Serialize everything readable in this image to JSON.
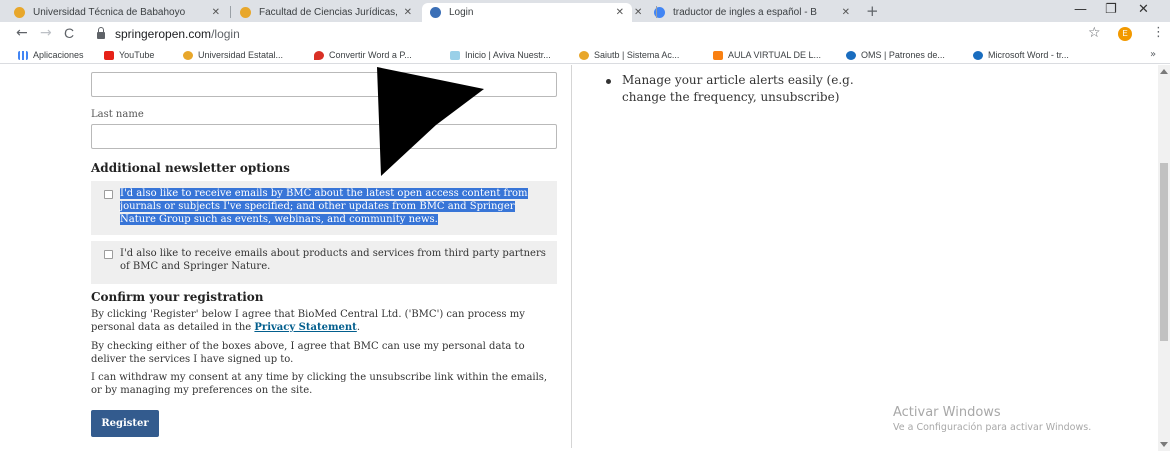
{
  "browser": {
    "tabs": [
      {
        "title": "Universidad Técnica de Babahoyo",
        "fav_color": "#e8a72b"
      },
      {
        "title": "Facultad de Ciencias Jurídicas, So",
        "fav_color": "#e8a72b"
      },
      {
        "title": "Login",
        "fav_color": "#3b6fb6"
      },
      {
        "title": "traductor de ingles a español - B",
        "fav_color": "#4285f4"
      }
    ],
    "close_glyph": "✕",
    "new_tab": "+",
    "window_controls": {
      "minimize": "—",
      "restore": "❐",
      "close": "✕"
    },
    "nav": {
      "back": "←",
      "forward": "→",
      "reload": "C"
    },
    "address": {
      "host": "springeropen.com",
      "path": "/login"
    },
    "star": "☆",
    "profile_initial": "E",
    "menu_glyph": "⋮"
  },
  "bookmarks": {
    "items": [
      {
        "label": "Aplicaciones",
        "icon": "apps-grid-icon",
        "color": "#4285f4"
      },
      {
        "label": "YouTube",
        "icon": "youtube-icon",
        "color": "#e62117"
      },
      {
        "label": "Universidad Estatal...",
        "icon": "university-icon",
        "color": "#e8a72b"
      },
      {
        "label": "Convertir Word a P...",
        "icon": "heart-icon",
        "color": "#d93025"
      },
      {
        "label": "Inicio | Aviva Nuestr...",
        "icon": "aviva-icon",
        "color": "#9ad0e8"
      },
      {
        "label": "Saiutb | Sistema Ac...",
        "icon": "saiutb-icon",
        "color": "#e8a72b"
      },
      {
        "label": "AULA VIRTUAL DE L...",
        "icon": "moodle-icon",
        "color": "#f98012"
      },
      {
        "label": "OMS | Patrones de...",
        "icon": "oms-icon",
        "color": "#1a6dbf"
      },
      {
        "label": "Microsoft Word - tr...",
        "icon": "oms-icon",
        "color": "#1a6dbf"
      }
    ],
    "more": "»"
  },
  "form": {
    "last_name_label": "Last name",
    "newsletter_heading": "Additional newsletter options",
    "option1": "I'd also like to receive emails by BMC about the latest open access content from journals or subjects I've specified; and other updates from BMC and Springer Nature Group such as events, webinars, and community news.",
    "option2": "I'd also like to receive emails about products and services from third party partners of BMC and Springer Nature.",
    "confirm_heading": "Confirm your registration",
    "para1_before": "By clicking 'Register' below I agree that BioMed Central Ltd. ('BMC') can process my personal data as detailed in the ",
    "para1_link": "Privacy Statement",
    "para1_after": ".",
    "para2": "By checking either of the boxes above, I agree that BMC can use my personal data to deliver the services I have signed up to.",
    "para3": "I can withdraw my consent at any time by clicking the unsubscribe link within the emails, or by managing my preferences on the site.",
    "register_label": "Register"
  },
  "sidebar": {
    "bullet": "Manage your article alerts easily (e.g. change the frequency, unsubscribe)"
  },
  "watermark": {
    "line1": "Activar Windows",
    "line2": "Ve a Configuración para activar Windows."
  }
}
